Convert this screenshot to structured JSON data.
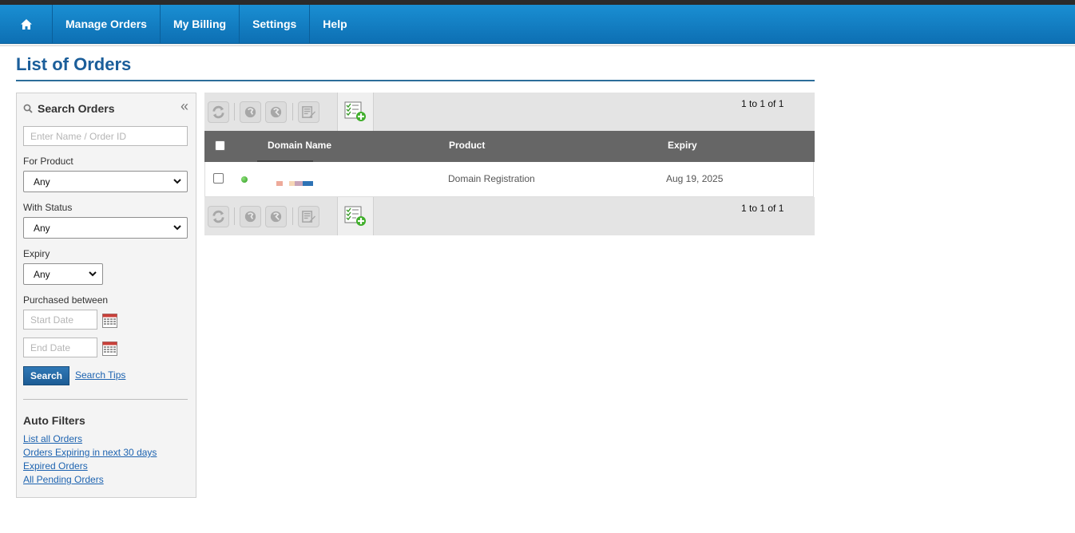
{
  "nav": {
    "home_icon": "home-icon",
    "items": [
      "Manage Orders",
      "My Billing",
      "Settings",
      "Help"
    ]
  },
  "page": {
    "title": "List of Orders"
  },
  "search": {
    "title": "Search Orders",
    "collapse_glyph": "«",
    "name_placeholder": "Enter Name / Order ID",
    "product_label": "For Product",
    "product_value": "Any",
    "status_label": "With Status",
    "status_value": "Any",
    "expiry_label": "Expiry",
    "expiry_value": "Any",
    "purchased_label": "Purchased between",
    "start_placeholder": "Start Date",
    "end_placeholder": "End Date",
    "search_button": "Search",
    "tips_link": "Search Tips"
  },
  "auto_filters": {
    "title": "Auto Filters",
    "links": [
      "List all Orders",
      "Orders Expiring in next 30 days",
      "Expired Orders",
      "All Pending Orders"
    ]
  },
  "toolbar": {
    "paging": "1 to 1 of 1",
    "buttons": [
      "refresh-icon",
      "suspend-icon",
      "unsuspend-icon",
      "edit-icon",
      "add-order-icon"
    ]
  },
  "table": {
    "headers": {
      "domain": "Domain Name",
      "product": "Product",
      "expiry": "Expiry"
    },
    "rows": [
      {
        "status": "active",
        "domain": "",
        "product": "Domain Registration",
        "expiry": "Aug 19, 2025"
      }
    ]
  },
  "colors": {
    "nav": "#0d6fb3",
    "title": "#1b5e9a",
    "link": "#1d63b0",
    "table_header": "#666666",
    "status_active": "#2b9a1e"
  }
}
